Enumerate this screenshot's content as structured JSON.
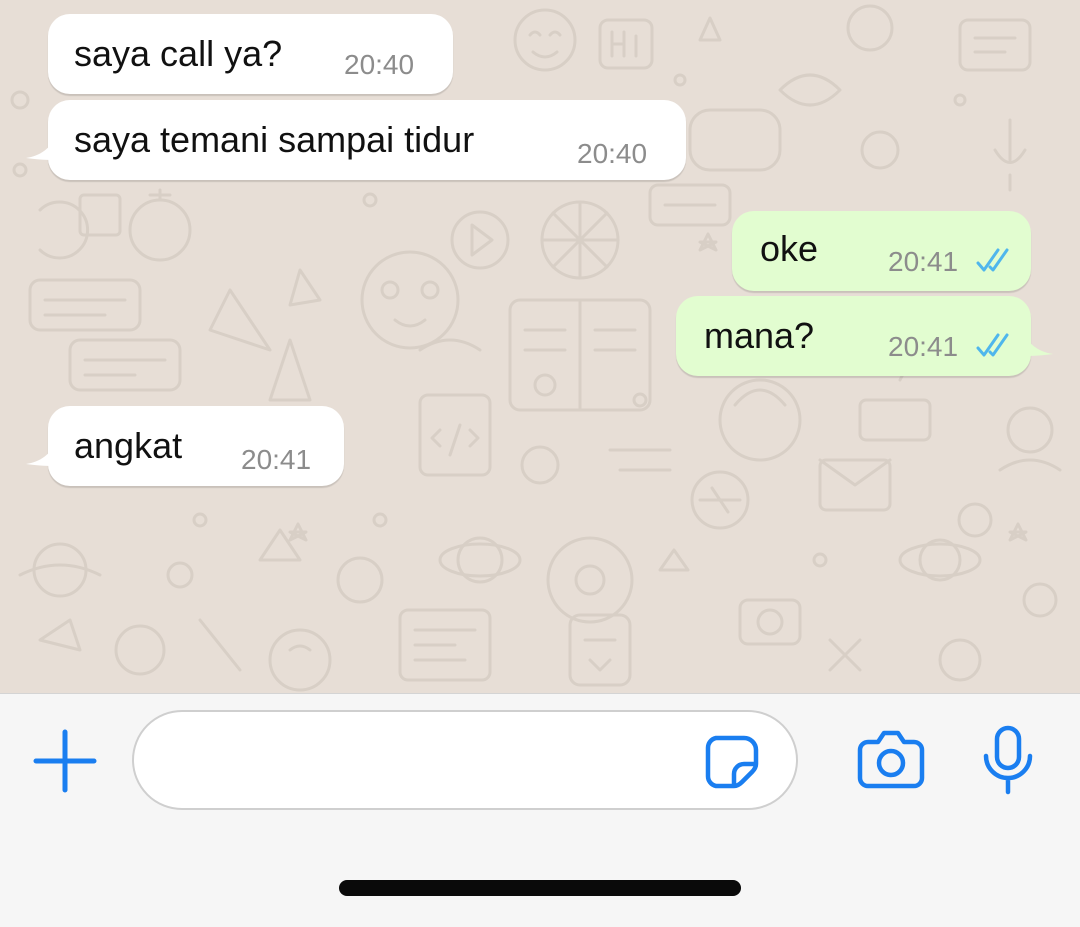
{
  "conversation": {
    "messages": [
      {
        "direction": "incoming",
        "text": "saya call ya?",
        "time": "20:40"
      },
      {
        "direction": "incoming",
        "text": "saya temani sampai tidur",
        "time": "20:40"
      },
      {
        "direction": "outgoing",
        "text": "oke",
        "time": "20:41",
        "status": "read"
      },
      {
        "direction": "outgoing",
        "text": "mana?",
        "time": "20:41",
        "status": "read"
      },
      {
        "direction": "incoming",
        "text": "angkat",
        "time": "20:41"
      }
    ]
  },
  "composer": {
    "message_value": "",
    "icons": {
      "attach": "plus-icon",
      "sticker": "sticker-icon",
      "camera": "camera-icon",
      "voice": "microphone-icon"
    }
  },
  "colors": {
    "chat_background": "#e7ded6",
    "incoming_bubble": "#ffffff",
    "outgoing_bubble": "#e2fdd0",
    "read_tick": "#4fb6ec",
    "accent": "#1a7ef0"
  }
}
